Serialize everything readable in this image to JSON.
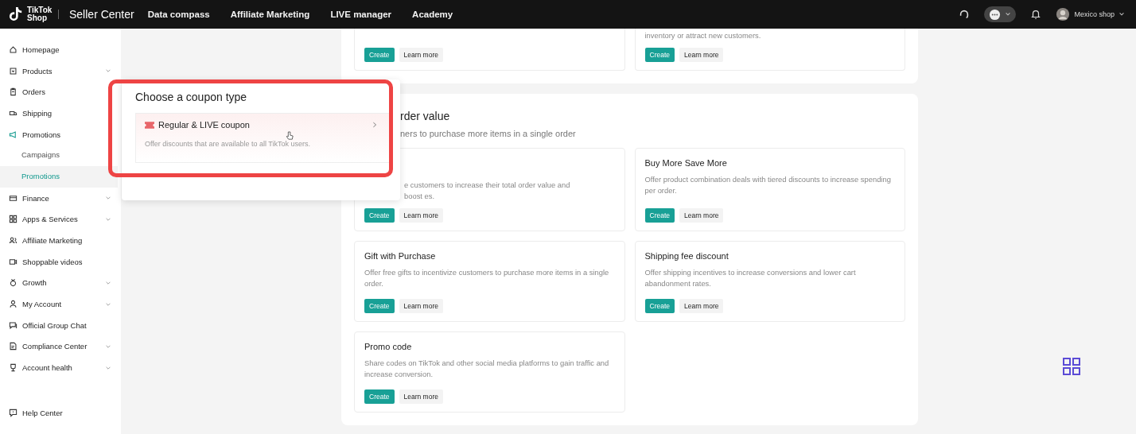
{
  "topbar": {
    "logo": "TikTok Shop",
    "title": "Seller Center",
    "nav": [
      "Data compass",
      "Affiliate Marketing",
      "LIVE manager",
      "Academy"
    ],
    "account": "Mexico shop"
  },
  "sidebar": {
    "items": [
      {
        "label": "Homepage",
        "expandable": false
      },
      {
        "label": "Products",
        "expandable": true
      },
      {
        "label": "Orders",
        "expandable": false
      },
      {
        "label": "Shipping",
        "expandable": false
      },
      {
        "label": "Promotions",
        "expandable": false,
        "children": [
          {
            "label": "Campaigns",
            "selected": false
          },
          {
            "label": "Promotions",
            "selected": true
          }
        ]
      },
      {
        "label": "Finance",
        "expandable": true
      },
      {
        "label": "Apps & Services",
        "expandable": true
      },
      {
        "label": "Affiliate Marketing",
        "expandable": false
      },
      {
        "label": "Shoppable videos",
        "expandable": false
      },
      {
        "label": "Growth",
        "expandable": true
      },
      {
        "label": "My Account",
        "expandable": true
      },
      {
        "label": "Official Group Chat",
        "expandable": false
      },
      {
        "label": "Compliance Center",
        "expandable": true
      },
      {
        "label": "Account health",
        "expandable": true
      }
    ],
    "footer": "Help Center"
  },
  "sections": [
    {
      "cards": [
        {
          "buttons": [
            "Create",
            "Learn more"
          ]
        },
        {
          "description": "inventory or attract new customers.",
          "buttons": [
            "Create",
            "Learn more"
          ]
        }
      ]
    },
    {
      "title": "rder value",
      "subtitle": "ners to purchase more items in a single order",
      "cards": [
        {
          "description": "e customers to increase their total order value and boost es.",
          "buttons": [
            "Create",
            "Learn more"
          ]
        },
        {
          "title": "Buy More Save More",
          "description": "Offer product combination deals with tiered discounts to increase spending per order.",
          "buttons": [
            "Create",
            "Learn more"
          ]
        },
        {
          "title": "Gift with Purchase",
          "description": "Offer free gifts to incentivize customers to purchase more items in a single order.",
          "buttons": [
            "Create",
            "Learn more"
          ]
        },
        {
          "title": "Shipping fee discount",
          "description": "Offer shipping incentives to increase conversions and lower cart abandonment rates.",
          "buttons": [
            "Create",
            "Learn more"
          ]
        },
        {
          "title": "Promo code",
          "description": "Share codes on TikTok and other social media platforms to gain traffic and increase conversion.",
          "buttons": [
            "Create",
            "Learn more"
          ]
        }
      ]
    }
  ],
  "popover": {
    "title": "Choose a coupon type",
    "options": [
      {
        "label": "Regular & LIVE coupon",
        "description": "Offer discounts that are available to all TikTok users.",
        "hovered": true
      }
    ]
  }
}
